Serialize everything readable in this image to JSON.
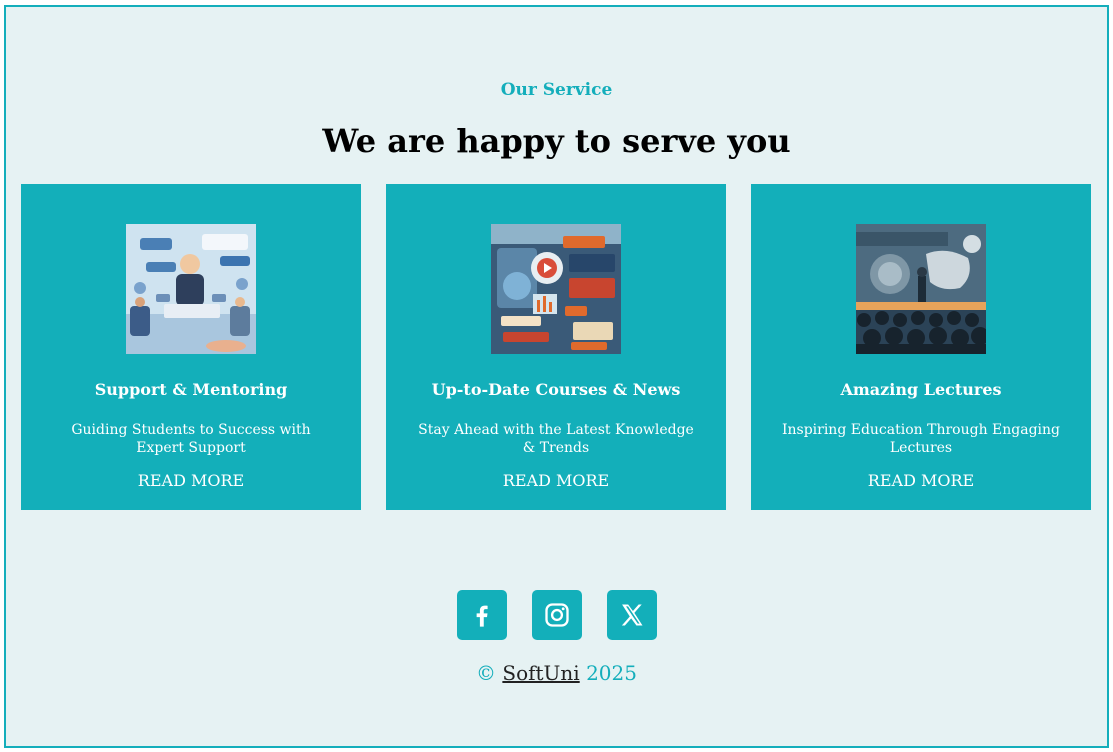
{
  "section": {
    "eyebrow": "Our Service",
    "title": "We are happy to serve you"
  },
  "cards": [
    {
      "title": "Support & Mentoring",
      "description": "Guiding Students to Success with Expert Support",
      "link": "READ MORE",
      "image_icon": "support-illustration"
    },
    {
      "title": "Up-to-Date Courses & News",
      "description": "Stay Ahead with the Latest Knowledge & Trends",
      "link": "READ MORE",
      "image_icon": "courses-news-illustration"
    },
    {
      "title": "Amazing Lectures",
      "description": "Inspiring Education Through Engaging Lectures",
      "link": "READ MORE",
      "image_icon": "lecture-illustration"
    }
  ],
  "socials": [
    {
      "name": "facebook-icon"
    },
    {
      "name": "instagram-icon"
    },
    {
      "name": "x-icon"
    }
  ],
  "footer": {
    "copyright_symbol": "©",
    "brand": "SoftUni",
    "year": "2025"
  },
  "colors": {
    "accent": "#13afba",
    "background": "#e6f2f3",
    "border": "#14aebb"
  }
}
